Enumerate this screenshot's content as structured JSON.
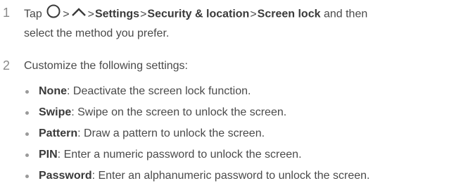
{
  "steps": [
    {
      "number": "1",
      "prefix": "Tap",
      "home_icon": "home-circle-icon",
      "sep1": ">",
      "up_icon": "chevron-up-icon",
      "sep2": ">",
      "path1": "Settings",
      "sep3": ">",
      "path2": "Security & location",
      "sep4": ">",
      "path3": "Screen lock",
      "suffix_line1": "and then",
      "line2": "select the method you prefer."
    },
    {
      "number": "2",
      "text": "Customize the following settings:"
    }
  ],
  "options": [
    {
      "term": "None",
      "desc": ": Deactivate the screen lock function."
    },
    {
      "term": "Swipe",
      "desc": ": Swipe on the screen to unlock the screen."
    },
    {
      "term": "Pattern",
      "desc": ": Draw a pattern to unlock the screen."
    },
    {
      "term": "PIN",
      "desc": ": Enter a numeric password to unlock the screen."
    },
    {
      "term": "Password",
      "desc": ": Enter an alphanumeric password to unlock the screen."
    }
  ]
}
